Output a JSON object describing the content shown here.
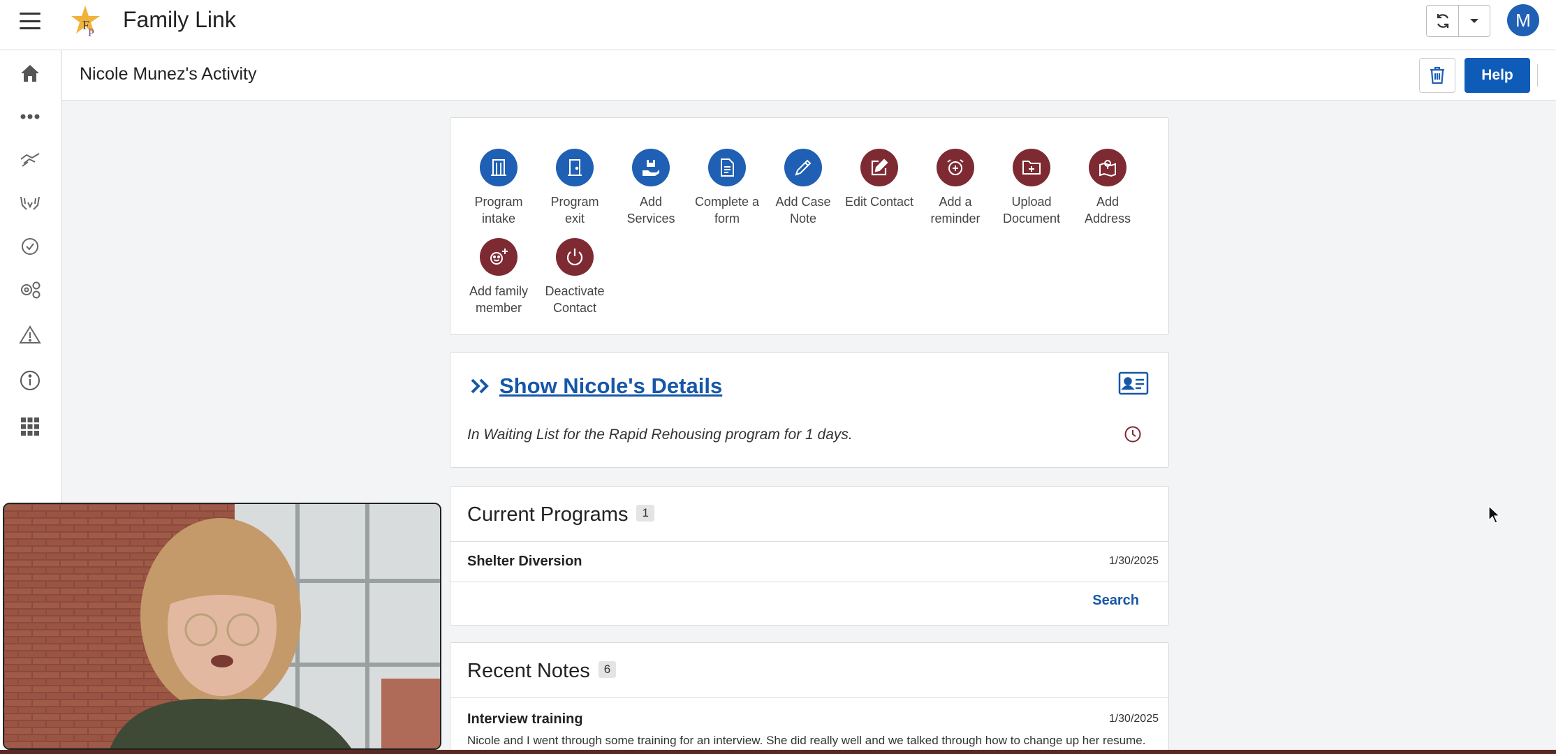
{
  "app": {
    "title": "Family Link",
    "avatar_initial": "M"
  },
  "page": {
    "title": "Nicole Munez's Activity"
  },
  "header": {
    "help_label": "Help"
  },
  "sidebar": {
    "icons": [
      "home-icon",
      "more-icon",
      "handshake-icon",
      "hands-icon",
      "badge-check-icon",
      "gears-icon",
      "warning-icon",
      "info-icon",
      "apps-grid-icon"
    ]
  },
  "actions": [
    {
      "label_1": "Program",
      "label_2": "intake",
      "icon": "building-icon",
      "color": "#1f5fb4"
    },
    {
      "label_1": "Program",
      "label_2": "exit",
      "icon": "door-icon",
      "color": "#1f5fb4"
    },
    {
      "label_1": "Add",
      "label_2": "Services",
      "icon": "hand-box-icon",
      "color": "#1f5fb4"
    },
    {
      "label_1": "Complete a",
      "label_2": "form",
      "icon": "document-icon",
      "color": "#1f5fb4"
    },
    {
      "label_1": "Add Case",
      "label_2": "Note",
      "icon": "pen-icon",
      "color": "#1f5fb4"
    },
    {
      "label_1": "Edit Contact",
      "label_2": "",
      "icon": "edit-icon",
      "color": "#7e2a33"
    },
    {
      "label_1": "Add a",
      "label_2": "reminder",
      "icon": "alarm-icon",
      "color": "#7e2a33"
    },
    {
      "label_1": "Upload",
      "label_2": "Document",
      "icon": "folder-plus-icon",
      "color": "#7e2a33"
    },
    {
      "label_1": "Add",
      "label_2": "Address",
      "icon": "map-icon",
      "color": "#7e2a33"
    },
    {
      "label_1": "Add family",
      "label_2": "member",
      "icon": "smile-plus-icon",
      "color": "#7e2a33"
    },
    {
      "label_1": "Deactivate",
      "label_2": "Contact",
      "icon": "power-icon",
      "color": "#7e2a33"
    }
  ],
  "details": {
    "link_label": "Show Nicole's Details",
    "status": "In Waiting List for the Rapid Rehousing program for 1 days."
  },
  "programs": {
    "title": "Current Programs",
    "count": "1",
    "items": [
      {
        "name": "Shelter Diversion",
        "date": "1/30/2025"
      }
    ],
    "search_label": "Search"
  },
  "notes": {
    "title": "Recent Notes",
    "count": "6",
    "items": [
      {
        "title": "Interview training",
        "date": "1/30/2025",
        "body": "Nicole and I went through some training for an interview. She did really well and we talked through how to change up her resume."
      }
    ]
  },
  "colors": {
    "primary": "#1f5fb4",
    "secondary": "#7e2a33",
    "link": "#1657a8"
  }
}
